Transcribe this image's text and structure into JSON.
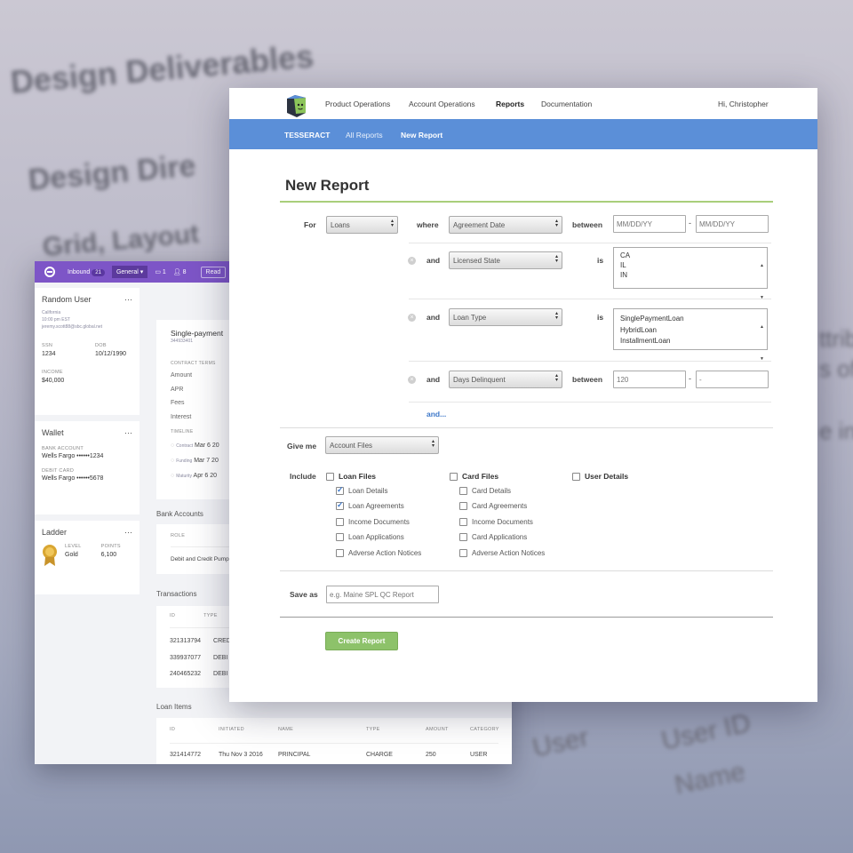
{
  "background": {
    "lines": [
      "Design Deliverables",
      "Design Dire",
      "Grid, Layout",
      "ttrib",
      "s of",
      "e in",
      "User",
      "User ID",
      "Name"
    ]
  },
  "crm": {
    "topbar": {
      "inbound_label": "Inbound",
      "inbound_count": "21",
      "general_label": "General",
      "count_a": "1",
      "count_b": "8",
      "read_label": "Read"
    },
    "user": {
      "name": "Random User",
      "location": "California",
      "time": "10:00 pm EST",
      "email": "jeremy.scott88@sbc.global.net",
      "ssn_label": "SSN",
      "ssn": "1234",
      "dob_label": "DOB",
      "dob": "10/12/1990",
      "income_label": "INCOME",
      "income": "$40,000"
    },
    "wallet": {
      "title": "Wallet",
      "bank_label": "BANK ACCOUNT",
      "bank": "Wells Fargo ••••••1234",
      "debit_label": "DEBIT CARD",
      "debit": "Wells Fargo ••••••5678"
    },
    "ladder": {
      "title": "Ladder",
      "level_label": "LEVEL",
      "level": "Gold",
      "points_label": "POINTS",
      "points": "6,100"
    },
    "loan": {
      "title": "Single-payment",
      "id": "344933401",
      "terms_label": "CONTRACT TERMS",
      "terms": [
        "Amount",
        "APR",
        "Fees",
        "Interest"
      ],
      "timeline_label": "TIMELINE",
      "timeline": [
        {
          "label": "Contract",
          "date": "Mar 6 20"
        },
        {
          "label": "Funding",
          "date": "Mar 7 20"
        },
        {
          "label": "Maturity",
          "date": "Apr 6 20"
        }
      ]
    },
    "bank_accounts": {
      "title": "Bank Accounts",
      "role_header": "ROLE",
      "row": "Debit and Credit Pump"
    },
    "transactions": {
      "title": "Transactions",
      "headers": [
        "ID",
        "TYPE"
      ],
      "rows": [
        [
          "321313794",
          "CRED"
        ],
        [
          "339937077",
          "DEBI"
        ],
        [
          "240465232",
          "DEBI"
        ]
      ]
    },
    "loan_items": {
      "title": "Loan Items",
      "headers": [
        "ID",
        "INITIATED",
        "NAME",
        "TYPE",
        "AMOUNT",
        "CATEGORY"
      ],
      "rows": [
        [
          "321414772",
          "Thu Nov 3 2016",
          "PRINCIPAL",
          "CHARGE",
          "250",
          "USER"
        ]
      ]
    }
  },
  "nav": {
    "links": [
      "Product Operations",
      "Account Operations",
      "Reports",
      "Documentation"
    ],
    "greeting": "Hi, Christopher"
  },
  "subnav": {
    "brand": "TESSERACT",
    "all_reports": "All Reports",
    "new_report": "New Report"
  },
  "form": {
    "title": "New Report",
    "for_label": "For",
    "for_value": "Loans",
    "where_label": "where",
    "where_field": "Agreement Date",
    "between_label": "between",
    "date_from_placeholder": "MM/DD/YY",
    "date_to_placeholder": "MM/DD/YY",
    "dash": "-",
    "and_label": "and",
    "is_label": "is",
    "licensed_state_field": "Licensed State",
    "states": [
      "CA",
      "IL",
      "IN"
    ],
    "loan_type_field": "Loan Type",
    "loan_types": [
      "SinglePaymentLoan",
      "HybridLoan",
      "InstallmentLoan"
    ],
    "days_delinquent_field": "Days Delinquent",
    "days_from_placeholder": "120",
    "days_to_placeholder": "-",
    "and_more": "and...",
    "give_me_label": "Give me",
    "give_me_value": "Account Files",
    "include_label": "Include",
    "loan_files": {
      "title": "Loan Files",
      "items": [
        "Loan Details",
        "Loan Agreements",
        "Income Documents",
        "Loan Applications",
        "Adverse Action Notices"
      ],
      "checked": [
        true,
        true,
        false,
        false,
        false
      ]
    },
    "card_files": {
      "title": "Card Files",
      "items": [
        "Card Details",
        "Card Agreements",
        "Income Documents",
        "Card Applications",
        "Adverse Action Notices"
      ],
      "checked": [
        false,
        false,
        false,
        false,
        false
      ]
    },
    "user_details": "User Details",
    "save_as_label": "Save as",
    "save_as_placeholder": "e.g. Maine SPL QC Report",
    "create_button": "Create Report"
  },
  "colors": {
    "purple": "#7d55c7",
    "blue": "#5b8fd8",
    "green": "#8dc26a",
    "green_line": "#a9cf7b"
  }
}
